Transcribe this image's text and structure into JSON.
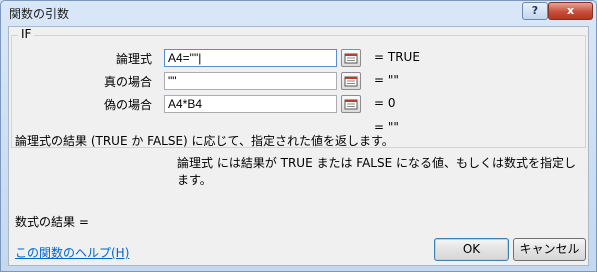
{
  "window": {
    "title": "関数の引数",
    "help_button": "?",
    "close_button": "x"
  },
  "function_name": "IF",
  "arguments": [
    {
      "label": "論理式",
      "value": "A4=\"\"|",
      "result": "= TRUE",
      "active": true
    },
    {
      "label": "真の場合",
      "value": "\"\"",
      "result": "= \"\""
    },
    {
      "label": "偽の場合",
      "value": "A4*B4",
      "result": "= 0"
    }
  ],
  "overall_result": "= \"\"",
  "function_description": "論理式の結果 (TRUE か FALSE) に応じて、指定された値を返します。",
  "argument_description": "論理式  には結果が TRUE または FALSE になる値、もしくは数式を指定します。",
  "formula_result_label": "数式の結果 =",
  "help_link": "この関数のヘルプ(H)",
  "buttons": {
    "ok": "OK",
    "cancel": "キャンセル"
  },
  "icons": {
    "ref_button": "collapse-dialog-icon"
  }
}
